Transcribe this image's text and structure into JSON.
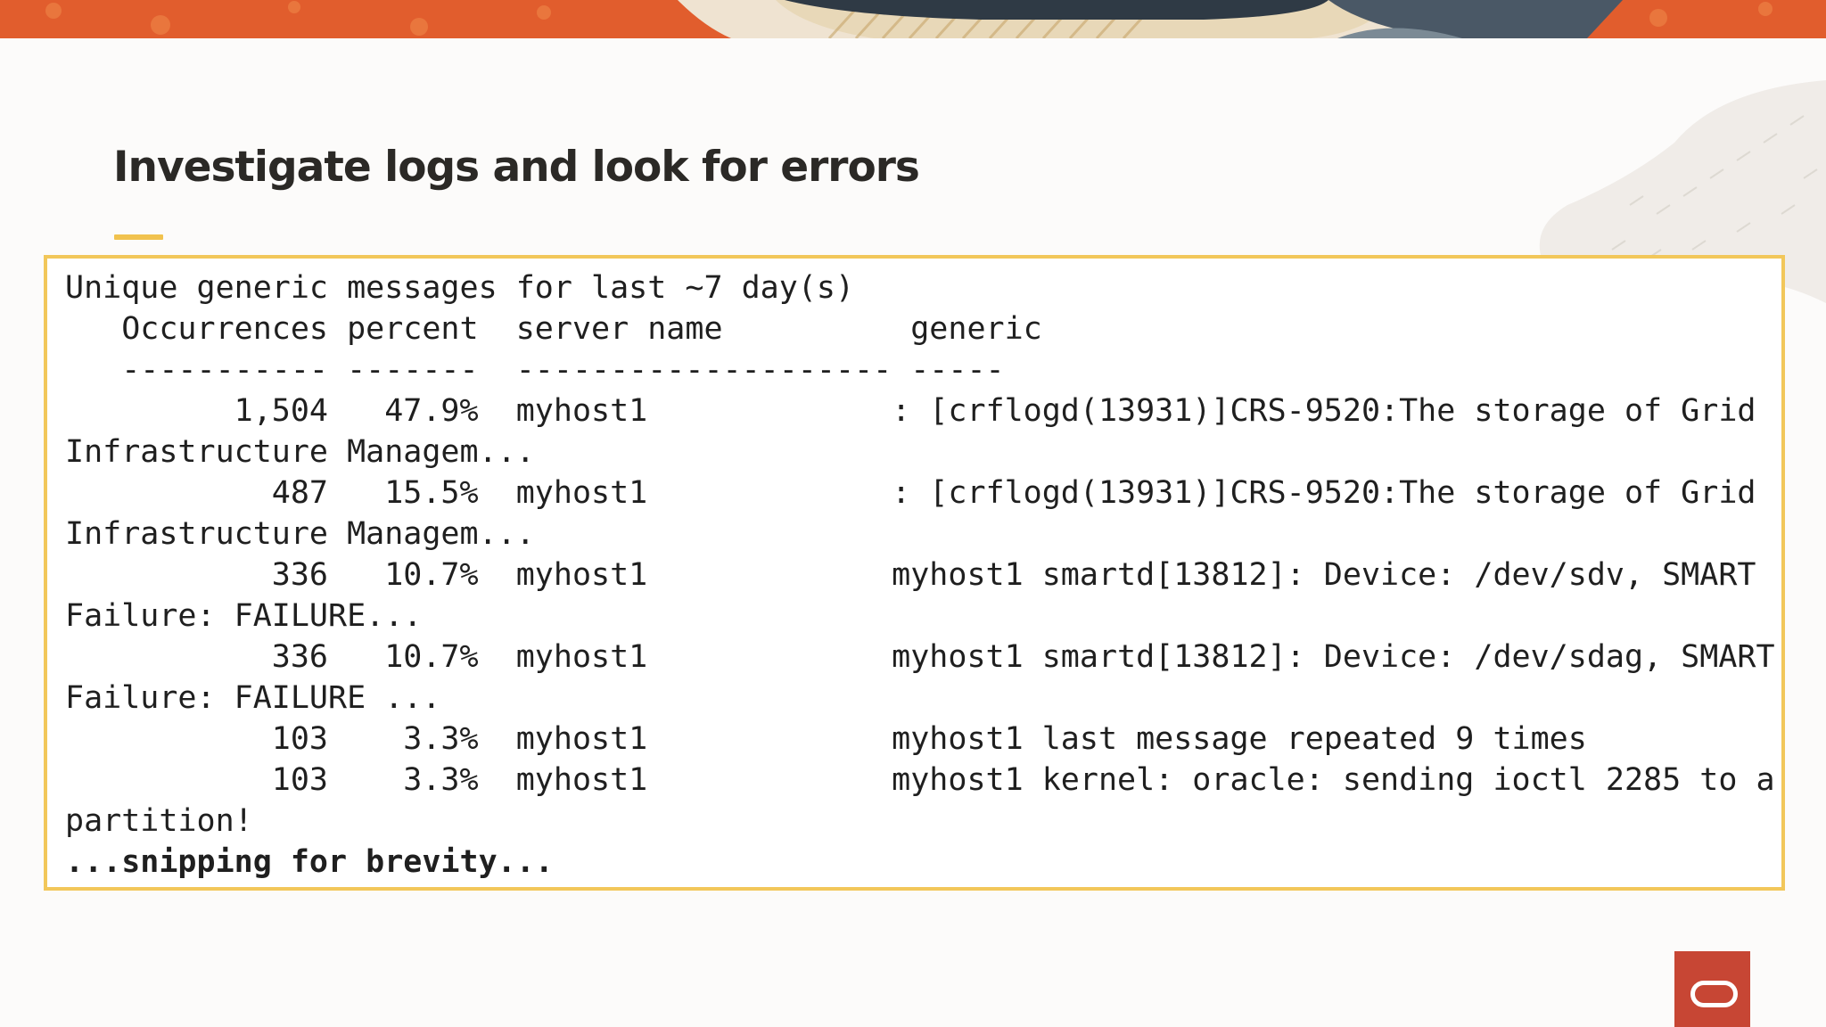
{
  "slide": {
    "title": "Investigate logs and look for errors"
  },
  "log": {
    "lines": [
      "Unique generic messages for last ~7 day(s)",
      "   Occurrences percent  server name          generic",
      "   ----------- -------  -------------------- -----",
      "         1,504   47.9%  myhost1             : [crflogd(13931)]CRS-9520:The storage of Grid",
      "Infrastructure Managem...",
      "           487   15.5%  myhost1             : [crflogd(13931)]CRS-9520:The storage of Grid",
      "Infrastructure Managem...",
      "           336   10.7%  myhost1             myhost1 smartd[13812]: Device: /dev/sdv, SMART",
      "Failure: FAILURE...",
      "           336   10.7%  myhost1             myhost1 smartd[13812]: Device: /dev/sdag, SMART",
      "Failure: FAILURE ...",
      "           103    3.3%  myhost1             myhost1 last message repeated 9 times",
      "           103    3.3%  myhost1             myhost1 kernel: oracle: sending ioctl 2285 to a",
      "partition!"
    ],
    "footer": "...snipping for brevity..."
  },
  "brand": {
    "logo_icon": "oracle-logo-icon",
    "logo_color": "#c74634"
  },
  "colors": {
    "accent": "#f1c24e",
    "box_border": "#f2c75a",
    "banner_orange": "#e4612d"
  }
}
